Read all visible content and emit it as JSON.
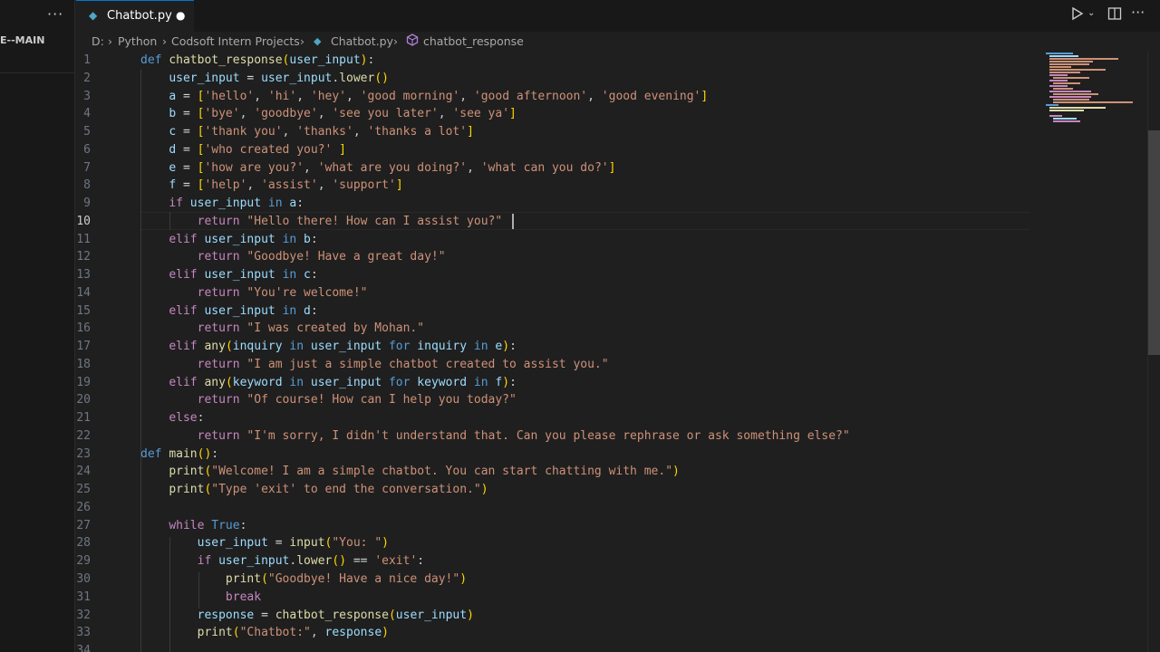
{
  "sidebar": {
    "menu_icon": "ellipsis-icon",
    "title": "E--MAIN"
  },
  "tab": {
    "label": "Chatbot.py",
    "modified_marker": "●",
    "icon": "python-file-icon"
  },
  "toolbar": {
    "run_icon": "play-icon",
    "chevron_icon": "chevron-down-icon",
    "split_icon": "split-editor-icon",
    "more_icon": "ellipsis-icon"
  },
  "breadcrumb": [
    "D:",
    "Python",
    "Codsoft Intern Projects",
    "Chatbot.py",
    "chatbot_response"
  ],
  "editor": {
    "active_line": 10,
    "lines": [
      "def chatbot_response(user_input):",
      "    user_input = user_input.lower()",
      "    a = ['hello', 'hi', 'hey', 'good morning', 'good afternoon', 'good evening']",
      "    b = ['bye', 'goodbye', 'see you later', 'see ya']",
      "    c = ['thank you', 'thanks', 'thanks a lot']",
      "    d = ['who created you?' ]",
      "    e = ['how are you?', 'what are you doing?', 'what can you do?']",
      "    f = ['help', 'assist', 'support']",
      "    if user_input in a:",
      "        return \"Hello there! How can I assist you?\"",
      "    elif user_input in b:",
      "        return \"Goodbye! Have a great day!\"",
      "    elif user_input in c:",
      "        return \"You're welcome!\"",
      "    elif user_input in d:",
      "        return \"I was created by Mohan.\"",
      "    elif any(inquiry in user_input for inquiry in e):",
      "        return \"I am just a simple chatbot created to assist you.\"",
      "    elif any(keyword in user_input for keyword in f):",
      "        return \"Of course! How can I help you today?\"",
      "    else:",
      "        return \"I'm sorry, I didn't understand that. Can you please rephrase or ask something else?\"",
      "def main():",
      "    print(\"Welcome! I am a simple chatbot. You can start chatting with me.\")",
      "    print(\"Type 'exit' to end the conversation.\")",
      "",
      "    while True:",
      "        user_input = input(\"You: \")",
      "        if user_input.lower() == 'exit':",
      "            print(\"Goodbye! Have a nice day!\")",
      "            break",
      "        response = chatbot_response(user_input)",
      "        print(\"Chatbot:\", response)",
      ""
    ]
  },
  "colors": {
    "keyword": "#569cd6",
    "control": "#c586c0",
    "function": "#dcdcaa",
    "variable": "#9cdcfe",
    "string": "#ce9178",
    "bracket1": "#ffd700",
    "bracket2": "#da70d6",
    "bracket3": "#179fff"
  }
}
